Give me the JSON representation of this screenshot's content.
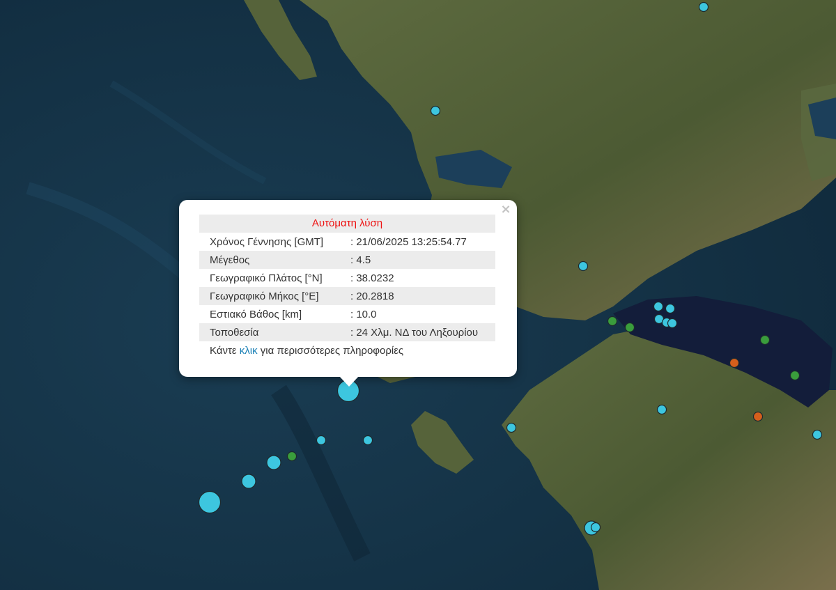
{
  "map": {
    "colors": {
      "sea": "#15354a",
      "sea_deep": "#102a3c",
      "land": "#56633a",
      "land_light": "#8a7d58",
      "gulf": "#131d3a",
      "marker_cyan": "#3dc6df",
      "marker_green": "#3a9d3c",
      "marker_orange": "#d55f1c"
    },
    "markers": [
      {
        "id": "m1",
        "color": "cyan",
        "mag": "small"
      },
      {
        "id": "m2",
        "color": "cyan",
        "mag": "small"
      },
      {
        "id": "m3",
        "color": "cyan",
        "mag": "small"
      },
      {
        "id": "m4",
        "color": "cyan",
        "mag": "small"
      },
      {
        "id": "m5",
        "color": "cyan",
        "mag": "small"
      },
      {
        "id": "m6",
        "color": "cyan",
        "mag": "small"
      },
      {
        "id": "m7",
        "color": "cyan",
        "mag": "small"
      },
      {
        "id": "m8",
        "color": "cyan",
        "mag": "small"
      },
      {
        "id": "m9",
        "color": "green",
        "mag": "small"
      },
      {
        "id": "m10",
        "color": "green",
        "mag": "small"
      },
      {
        "id": "m11",
        "color": "green",
        "mag": "small"
      },
      {
        "id": "m12",
        "color": "green",
        "mag": "small"
      },
      {
        "id": "m13",
        "color": "orange",
        "mag": "small"
      },
      {
        "id": "m14",
        "color": "orange",
        "mag": "small"
      },
      {
        "id": "m15",
        "color": "cyan",
        "mag": "small"
      },
      {
        "id": "m16",
        "color": "cyan",
        "mag": "small"
      },
      {
        "id": "m17",
        "color": "cyan",
        "mag": "small"
      },
      {
        "id": "m18",
        "color": "cyan",
        "mag": "selected"
      },
      {
        "id": "m19",
        "color": "cyan",
        "mag": "small"
      },
      {
        "id": "m20",
        "color": "cyan",
        "mag": "small"
      },
      {
        "id": "m21",
        "color": "green",
        "mag": "small"
      },
      {
        "id": "m22",
        "color": "cyan",
        "mag": "medium"
      },
      {
        "id": "m23",
        "color": "cyan",
        "mag": "medium"
      },
      {
        "id": "m24",
        "color": "cyan",
        "mag": "large"
      },
      {
        "id": "m25",
        "color": "cyan",
        "mag": "medium"
      },
      {
        "id": "m26",
        "color": "cyan",
        "mag": "small"
      }
    ]
  },
  "popup": {
    "close_label": "×",
    "title": "Αυτόματη λύση",
    "rows": [
      {
        "label": "Χρόνος Γέννησης [GMT]",
        "value": ": 21/06/2025 13:25:54.77"
      },
      {
        "label": "Μέγεθος",
        "value": ": 4.5"
      },
      {
        "label": "Γεωγραφικό Πλάτος [°N]",
        "value": ": 38.0232"
      },
      {
        "label": "Γεωγραφικό Μήκος [°E]",
        "value": ": 20.2818"
      },
      {
        "label": "Εστιακό Βάθος [km]",
        "value": ": 10.0"
      },
      {
        "label": "Τοποθεσία",
        "value": ": 24 Χλμ. ΝΔ του Ληξουρίου"
      }
    ],
    "more_prefix": "Κάντε ",
    "more_link": "κλικ",
    "more_suffix": " για περισσότερες πληροφορίες"
  }
}
